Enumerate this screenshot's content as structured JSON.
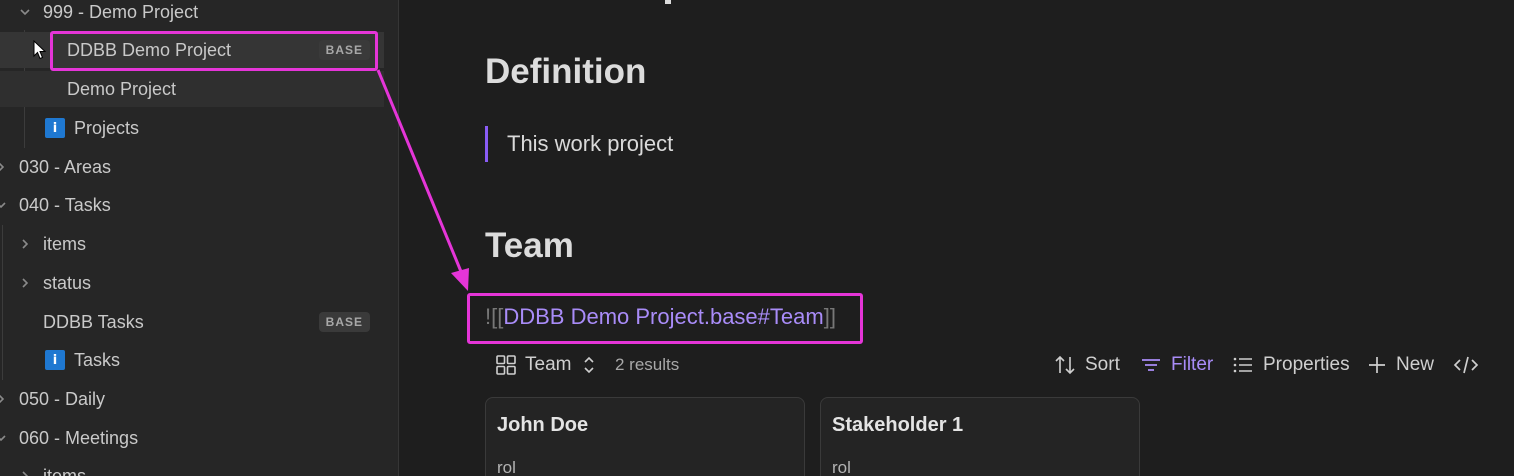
{
  "sidebar": {
    "items": [
      {
        "label": "999 - Demo Project",
        "chevron": "down"
      },
      {
        "label": "DDBB Demo Project",
        "badge": "BASE"
      },
      {
        "label": "Demo Project"
      },
      {
        "label": "Projects",
        "icon": "info-icon",
        "icon_glyph": "i"
      },
      {
        "label": "030 - Areas",
        "chevron": "right"
      },
      {
        "label": "040 - Tasks",
        "chevron": "down"
      },
      {
        "label": "items",
        "chevron": "right"
      },
      {
        "label": "status",
        "chevron": "right"
      },
      {
        "label": "DDBB Tasks",
        "badge": "BASE"
      },
      {
        "label": "Tasks",
        "icon": "info-icon",
        "icon_glyph": "i"
      },
      {
        "label": "050 - Daily",
        "chevron": "right"
      },
      {
        "label": "060 - Meetings",
        "chevron": "down"
      },
      {
        "label": "items",
        "chevron": "right"
      }
    ]
  },
  "main": {
    "sections": {
      "definition": "Definition",
      "definition_quote": "This work project",
      "team": "Team"
    },
    "embed": {
      "open": "![[",
      "link": "DDBB Demo Project.base#Team",
      "close": "]]"
    },
    "base_toolbar": {
      "view_name": "Team",
      "results": "2 results",
      "sort": "Sort",
      "filter": "Filter",
      "properties": "Properties",
      "new": "New"
    },
    "cards": [
      {
        "title": "John Doe",
        "property": "rol"
      },
      {
        "title": "Stakeholder 1",
        "property": "rol"
      }
    ]
  },
  "colors": {
    "accent": "#a98cf8",
    "annotation": "#e535d8",
    "info_icon": "#1f78d1"
  }
}
